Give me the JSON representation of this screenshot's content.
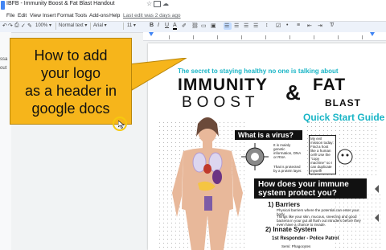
{
  "window": {
    "title": "IBFB - Immunity Boost & Fat Blast Handout",
    "star_icon": "star-icon",
    "move_icon": "folder-move-icon",
    "cloud_icon": "cloud-status-icon"
  },
  "menu": {
    "items": [
      "File",
      "Edit",
      "View",
      "Insert",
      "Format",
      "Tools",
      "Add-ons",
      "Help"
    ],
    "last_edit": "Last edit was 2 days ago"
  },
  "toolbar": {
    "zoom": "100%",
    "style": "Normal text",
    "font": "Arial",
    "size": "11",
    "bold": "B",
    "italic": "I",
    "underline": "U",
    "text_color": "A"
  },
  "outline": {
    "line1": "ssa",
    "line2": "out"
  },
  "callout": {
    "line1": "How to add",
    "line2": "your logo",
    "line3": "as a header in",
    "line4": "google docs",
    "color": "#f6b51b"
  },
  "document": {
    "tagline": "The secret to staying healthy no one is talking about",
    "title_word1": "IMMUNITY",
    "title_amp": "&",
    "title_word2": "FAT",
    "title_word3": "BOOST",
    "title_word4": "BLAST",
    "subtitle": "Quick Start Guide",
    "virus_heading": "What is a virus?",
    "virus_facts": [
      "It is mainly genetic information, DNA or RNA",
      "That is protected by a protein layer."
    ],
    "mission_text": "My evil mission today: Find a host like a human cell! Use the \"copy machine\" so I can duplicate myself!",
    "immune_heading_1": "How does your immune",
    "immune_heading_2": "system protect you?",
    "barriers_label": "1) Barriers",
    "barriers_text": "Physical barriers where the potential can enter your body.",
    "barriers_text2": "Things like your skin, mucous, sneezing and good bacteria in your gut all flush out intruders before they even have a chance to invade.",
    "innate_label": "2) Innate System",
    "responder_label": "1st Responder - Police Patrol",
    "responder_item": "Semi: Phagocytes",
    "accent_color": "#19b5c6"
  }
}
